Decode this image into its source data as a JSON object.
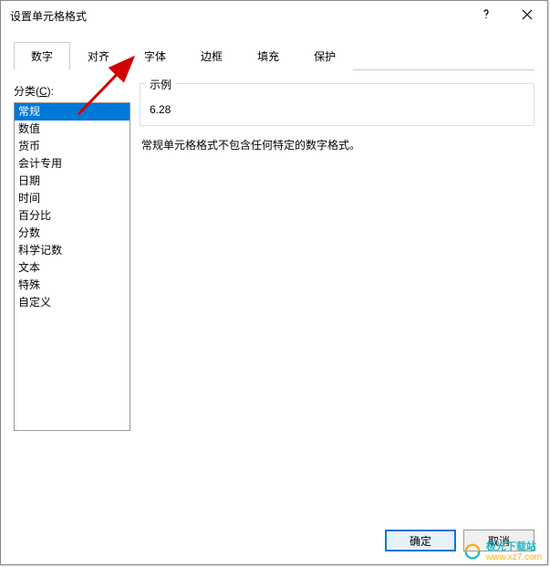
{
  "dialog": {
    "title": "设置单元格格式"
  },
  "tabs": {
    "items": [
      {
        "label": "数字"
      },
      {
        "label": "对齐"
      },
      {
        "label": "字体"
      },
      {
        "label": "边框"
      },
      {
        "label": "填充"
      },
      {
        "label": "保护"
      }
    ]
  },
  "category": {
    "label_prefix": "分类(",
    "label_underline": "C",
    "label_suffix": "):",
    "items": [
      {
        "label": "常规"
      },
      {
        "label": "数值"
      },
      {
        "label": "货币"
      },
      {
        "label": "会计专用"
      },
      {
        "label": "日期"
      },
      {
        "label": "时间"
      },
      {
        "label": "百分比"
      },
      {
        "label": "分数"
      },
      {
        "label": "科学记数"
      },
      {
        "label": "文本"
      },
      {
        "label": "特殊"
      },
      {
        "label": "自定义"
      }
    ]
  },
  "example": {
    "label": "示例",
    "value": "6.28"
  },
  "description": "常规单元格格式不包含任何特定的数字格式。",
  "buttons": {
    "ok": "确定",
    "cancel": "取消"
  },
  "watermark": {
    "name": "极光下载站",
    "url": "www.xz7.com"
  }
}
